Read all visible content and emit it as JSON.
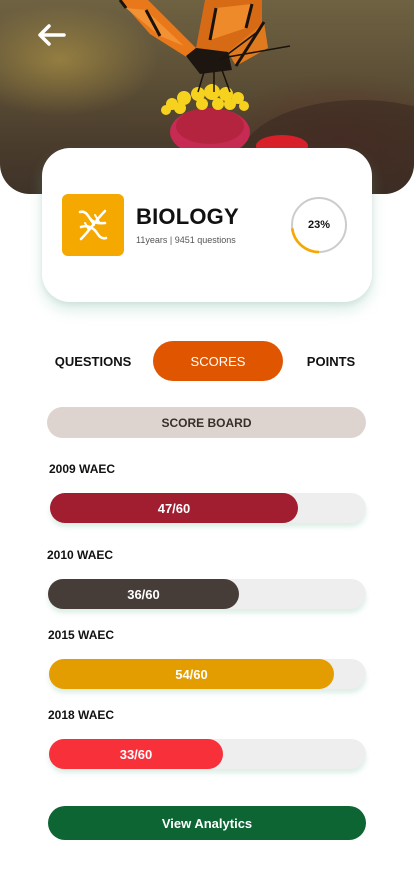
{
  "subject": {
    "title": "BIOLOGY",
    "meta": "11years | 9451 questions",
    "icon": "dna-icon",
    "progress_percent": 23,
    "progress_label": "23%"
  },
  "tabs": [
    {
      "label": "QUESTIONS",
      "active": false
    },
    {
      "label": "SCORES",
      "active": true
    },
    {
      "label": "POINTS",
      "active": false
    }
  ],
  "scoreboard": {
    "title": "SCORE BOARD",
    "entries": [
      {
        "exam": "2009 WAEC",
        "score": 47,
        "total": 60,
        "label": "47/60",
        "color": "#a01e30"
      },
      {
        "exam": "2010 WAEC",
        "score": 36,
        "total": 60,
        "label": "36/60",
        "color": "#473d38"
      },
      {
        "exam": "2015 WAEC",
        "score": 54,
        "total": 60,
        "label": "54/60",
        "color": "#e49d00"
      },
      {
        "exam": "2018 WAEC",
        "score": 33,
        "total": 60,
        "label": "33/60",
        "color": "#f8303a"
      }
    ]
  },
  "analytics_button": {
    "label": "View Analytics"
  },
  "colors": {
    "accent": "#e05600",
    "subject_icon_bg": "#f5a800",
    "progress": "#f5a800",
    "button": "#0c6532"
  }
}
